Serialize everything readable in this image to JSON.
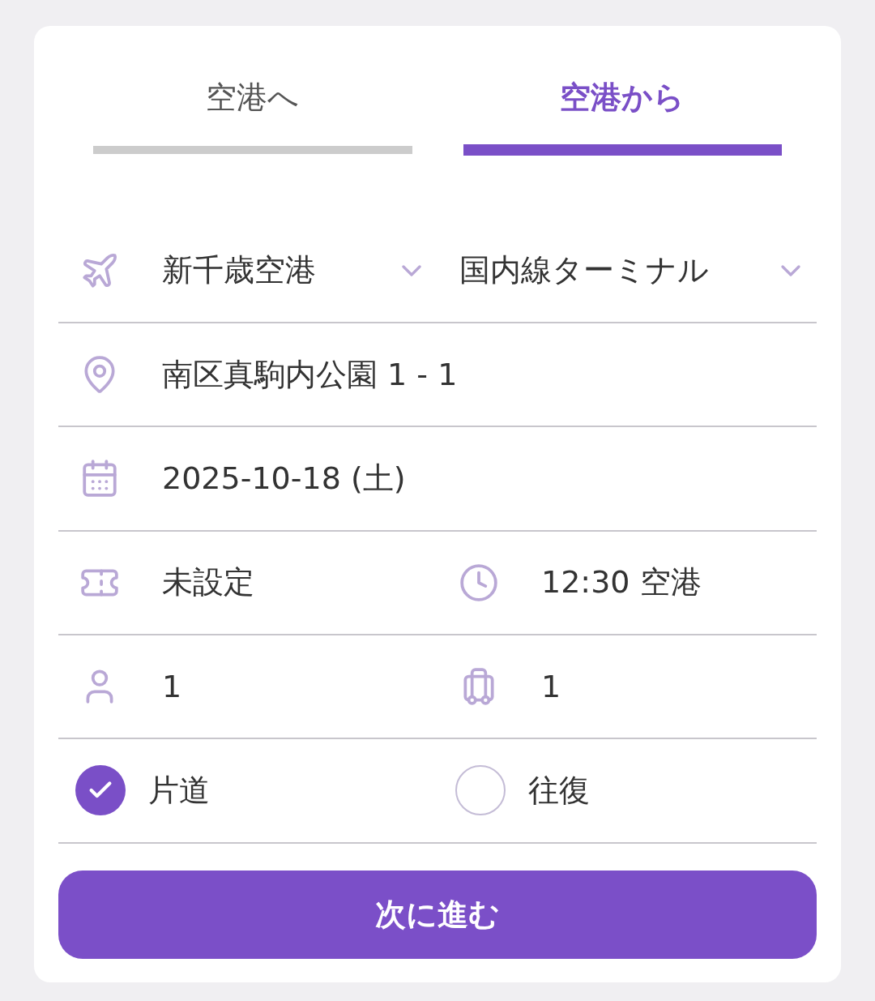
{
  "tabs": [
    {
      "label": "空港へ",
      "selected": false
    },
    {
      "label": "空港から",
      "selected": true
    }
  ],
  "airport": "新千歳空港",
  "terminal": "国内線ターミナル",
  "address": "南区真駒内公園 1 - 1",
  "date": "2025-10-18 (土)",
  "flight": "未設定",
  "time": "12:30 空港",
  "passengers": "1",
  "luggage": "1",
  "trip_types": [
    {
      "label": "片道",
      "selected": true
    },
    {
      "label": "往復",
      "selected": false
    }
  ],
  "next_button": "次に進む"
}
